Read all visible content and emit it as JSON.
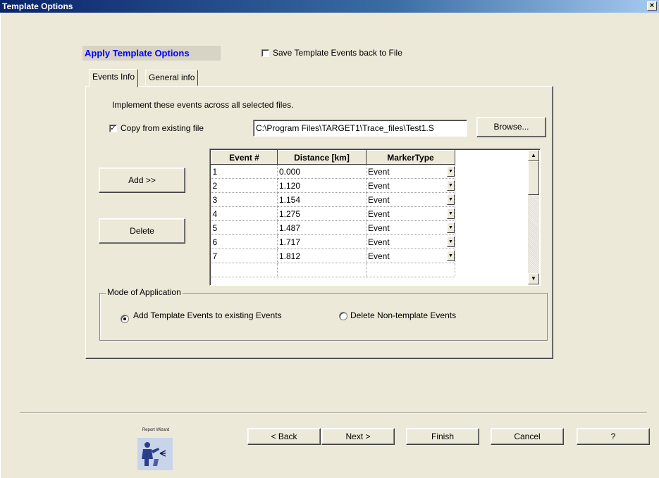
{
  "window": {
    "title": "Template Options",
    "close_icon": "close-icon"
  },
  "header": {
    "heading": "Apply Template Options",
    "save_back_label": "Save Template Events back to  File",
    "save_back_checked": false
  },
  "tabs": [
    {
      "label": "Events Info",
      "active": true
    },
    {
      "label": "General info",
      "active": false
    }
  ],
  "events_tab": {
    "instruction": "Implement these events across all selected files.",
    "copy_label": "Copy from existing file",
    "copy_checked": true,
    "file_path": "C:\\Program Files\\TARGET1\\Trace_files\\Test1.S",
    "browse_label": "Browse...",
    "add_label": "Add >>",
    "delete_label": "Delete"
  },
  "events_table": {
    "columns": [
      "Event #",
      "Distance [km]",
      "MarkerType"
    ],
    "rows": [
      {
        "num": "1",
        "distance": "0.000",
        "marker": "Event"
      },
      {
        "num": "2",
        "distance": "1.120",
        "marker": "Event"
      },
      {
        "num": "3",
        "distance": "1.154",
        "marker": "Event"
      },
      {
        "num": "4",
        "distance": "1.275",
        "marker": "Event"
      },
      {
        "num": "5",
        "distance": "1.487",
        "marker": "Event"
      },
      {
        "num": "6",
        "distance": "1.717",
        "marker": "Event"
      },
      {
        "num": "7",
        "distance": "1.812",
        "marker": "Event"
      }
    ]
  },
  "mode": {
    "legend": "Mode of Application",
    "option_add": "Add Template Events to existing Events",
    "option_delete": "Delete Non-template Events",
    "selected": "add"
  },
  "footer": {
    "logo_text": "Report Wizard",
    "back_label": "< Back",
    "next_label": "Next >",
    "finish_label": "Finish",
    "cancel_label": "Cancel",
    "help_label": "?"
  }
}
